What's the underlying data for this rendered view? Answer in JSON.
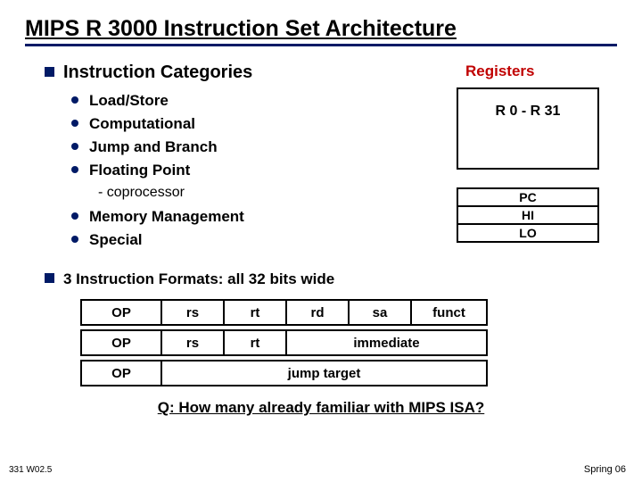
{
  "title": "MIPS R 3000 Instruction Set Architecture",
  "section1_heading": "Instruction Categories",
  "registers_heading": "Registers",
  "categories_a": {
    "0": "Load/Store",
    "1": "Computational",
    "2": "Jump and Branch",
    "3": "Floating Point"
  },
  "sub_cop": "-  coprocessor",
  "categories_b": {
    "0": "Memory Management",
    "1": "Special"
  },
  "reg_big": "R 0 - R 31",
  "reg_rows": {
    "0": "PC",
    "1": "HI",
    "2": "LO"
  },
  "section2_heading": "3 Instruction Formats: all 32 bits wide",
  "fmt": {
    "r": {
      "op": "OP",
      "rs": "rs",
      "rt": "rt",
      "rd": "rd",
      "sa": "sa",
      "funct": "funct"
    },
    "i": {
      "op": "OP",
      "rs": "rs",
      "rt": "rt",
      "imm": "immediate"
    },
    "j": {
      "op": "OP",
      "target": "jump target"
    }
  },
  "question": "Q: How many already familiar with MIPS ISA?",
  "footer_left": "331 W02.5",
  "footer_right": "Spring 06"
}
